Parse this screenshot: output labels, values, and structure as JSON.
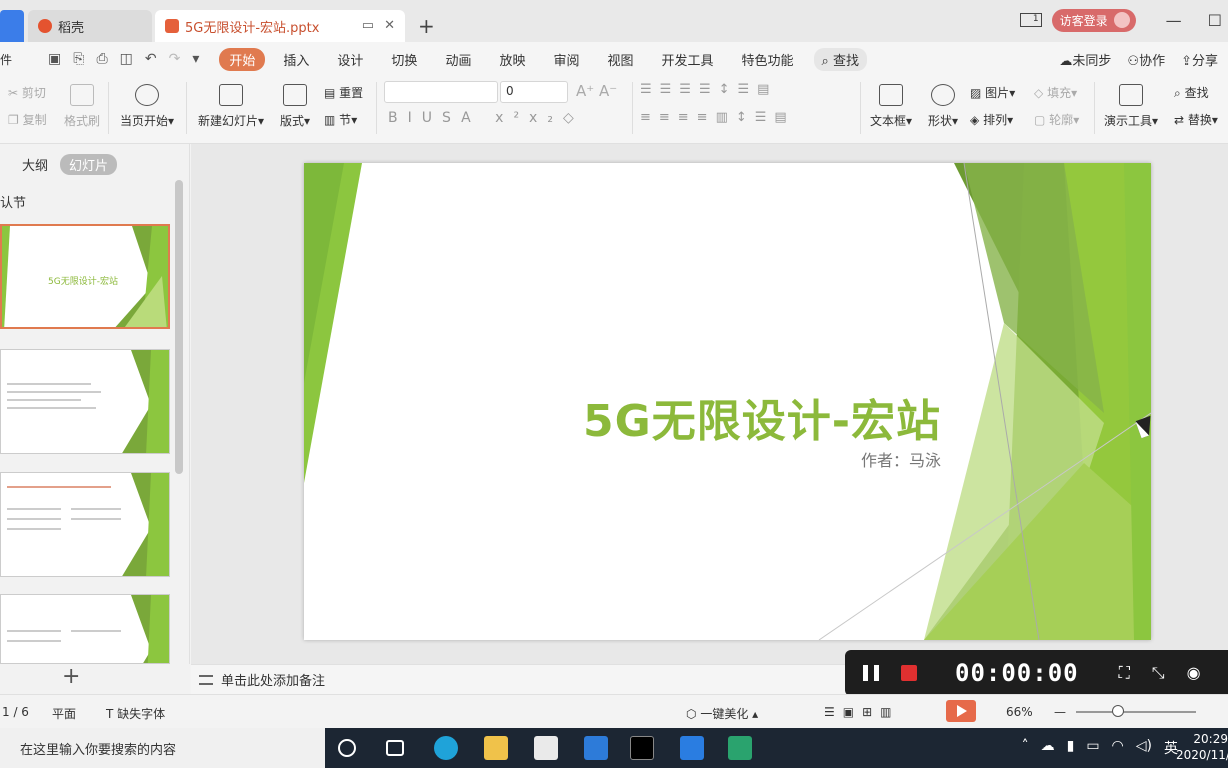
{
  "titlebar": {
    "tab_daoke": "稻壳",
    "tab_doc": "5G无限设计-宏站.pptx",
    "layout_btn": "1",
    "visitor_login": "访客登录"
  },
  "menu": {
    "file": "件",
    "tabs": [
      "开始",
      "插入",
      "设计",
      "切换",
      "动画",
      "放映",
      "审阅",
      "视图",
      "开发工具",
      "特色功能"
    ],
    "search": "查找",
    "unsync": "未同步",
    "collab": "协作",
    "share": "分享"
  },
  "ribbon": {
    "cut": "剪切",
    "copy": "复制",
    "format_painter": "格式刷",
    "from_current": "当页开始",
    "new_slide": "新建幻灯片",
    "layout": "版式",
    "reset": "重置",
    "section": "节",
    "font_size": "0",
    "textbox": "文本框",
    "shape": "形状",
    "picture": "图片",
    "arrange": "排列",
    "fill": "填充",
    "outline": "轮廓",
    "present_tools": "演示工具",
    "find": "查找",
    "replace": "替换"
  },
  "panel": {
    "outline_tab": "大纲",
    "slides_tab": "幻灯片",
    "section": "认节",
    "thumb1_title": "5G无限设计-宏站"
  },
  "slide": {
    "title": "5G无限设计-宏站",
    "author": "作者：马泳"
  },
  "notes": {
    "placeholder": "单击此处添加备注"
  },
  "recorder": {
    "timer": "00:00:00"
  },
  "status": {
    "page": "1 / 6",
    "view": "平面",
    "missing_font": "缺失字体",
    "beautify": "一键美化",
    "zoom": "66%"
  },
  "taskbar": {
    "search_placeholder": "在这里输入你要搜索的内容",
    "ime": "英",
    "time": "20:29",
    "date": "2020/11/"
  },
  "colors": {
    "accent": "#e07a4f",
    "slide_green": "#8cb93b",
    "taskbar": "#1c2633"
  }
}
